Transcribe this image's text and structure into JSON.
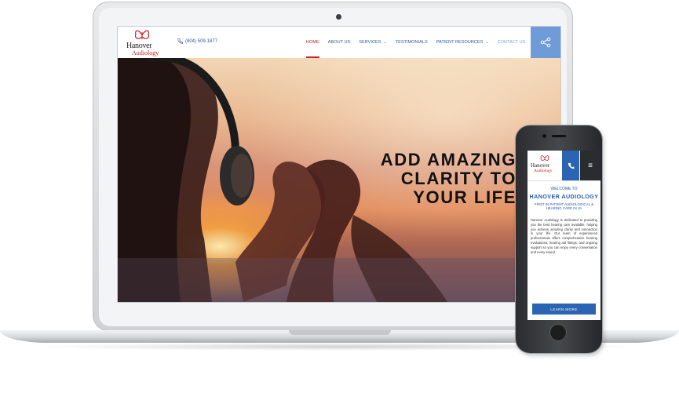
{
  "site": {
    "logo_line1": "Hanover",
    "logo_line2": "Audiology",
    "phone": "(804) 509-1877",
    "nav": [
      {
        "label": "HOME"
      },
      {
        "label": "ABOUT US"
      },
      {
        "label": "SERVICES"
      },
      {
        "label": "TESTIMONIALS"
      },
      {
        "label": "PATIENT RESOURCES"
      },
      {
        "label": "CONTACT US"
      }
    ],
    "hero": {
      "line1": "ADD AMAZING",
      "line2": "CLARITY TO",
      "line3": "YOUR LIFE"
    }
  },
  "mobile": {
    "welcome": "WELCOME TO",
    "brand": "HANOVER AUDIOLOGY",
    "tagline": "FIRST IN PATIENT AUDIOLOGICAL & HEARING CARE IN VA",
    "body": "Hanover Audiology is dedicated to providing you the best hearing care available, helping you achieve amazing clarity and connection in your life. Our team of experienced professionals offers comprehensive hearing evaluations, hearing aid fittings, and ongoing support so you can enjoy every conversation and every sound.",
    "cta": "LEARN MORE"
  },
  "colors": {
    "brand_blue": "#2a5aa8",
    "brand_red": "#c8202f",
    "share_blue": "#6f9bd8"
  },
  "icons": {
    "phone": "phone-icon",
    "share": "share-icon",
    "menu": "hamburger-icon",
    "caret": "chevron-down-icon"
  }
}
